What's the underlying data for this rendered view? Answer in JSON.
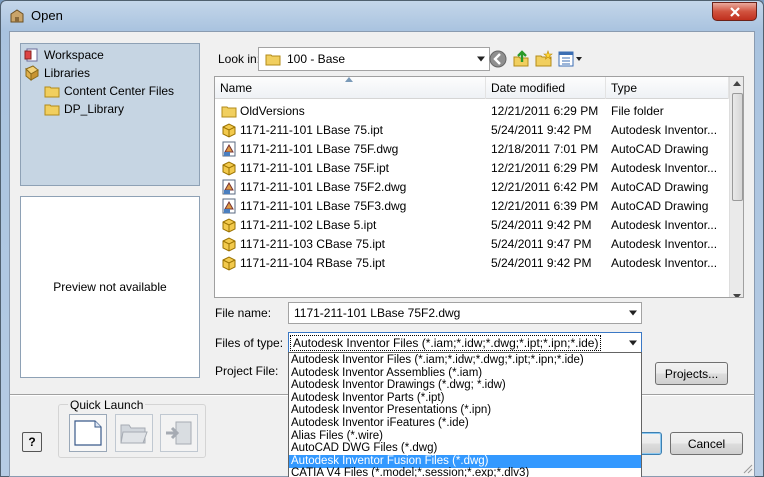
{
  "window": {
    "title": "Open"
  },
  "places": {
    "items": [
      {
        "label": "Workspace",
        "icon": "workspace-icon"
      },
      {
        "label": "Libraries",
        "icon": "libraries-icon"
      },
      {
        "label": "Content Center Files",
        "icon": "folder-icon"
      },
      {
        "label": "DP_Library",
        "icon": "folder-icon"
      }
    ]
  },
  "preview": {
    "text": "Preview not available"
  },
  "lookin": {
    "label": "Look in:",
    "value": "100 - Base"
  },
  "filelist": {
    "columns": [
      "Name",
      "Date modified",
      "Type"
    ],
    "rows": [
      {
        "name": "OldVersions",
        "date": "12/21/2011 6:29 PM",
        "type": "File folder",
        "icon": "folder-icon"
      },
      {
        "name": "1171-211-101 LBase 75.ipt",
        "date": "5/24/2011 9:42 PM",
        "type": "Autodesk Inventor...",
        "icon": "inventor-part-icon"
      },
      {
        "name": "1171-211-101 LBase 75F.dwg",
        "date": "12/18/2011 7:01 PM",
        "type": "AutoCAD Drawing",
        "icon": "dwg-icon"
      },
      {
        "name": "1171-211-101 LBase 75F.ipt",
        "date": "12/21/2011 6:29 PM",
        "type": "Autodesk Inventor...",
        "icon": "inventor-part-icon"
      },
      {
        "name": "1171-211-101 LBase 75F2.dwg",
        "date": "12/21/2011 6:42 PM",
        "type": "AutoCAD Drawing",
        "icon": "dwg-icon"
      },
      {
        "name": "1171-211-101 LBase 75F3.dwg",
        "date": "12/21/2011 6:39 PM",
        "type": "AutoCAD Drawing",
        "icon": "dwg-icon"
      },
      {
        "name": "1171-211-102 LBase 5.ipt",
        "date": "5/24/2011 9:42 PM",
        "type": "Autodesk Inventor...",
        "icon": "inventor-part-icon"
      },
      {
        "name": "1171-211-103 CBase 75.ipt",
        "date": "5/24/2011 9:47 PM",
        "type": "Autodesk Inventor...",
        "icon": "inventor-part-icon"
      },
      {
        "name": "1171-211-104 RBase 75.ipt",
        "date": "5/24/2011 9:42 PM",
        "type": "Autodesk Inventor...",
        "icon": "inventor-part-icon"
      }
    ]
  },
  "filename": {
    "label": "File name:",
    "value": "1171-211-101 LBase 75F2.dwg"
  },
  "filetype": {
    "label": "Files of type:",
    "value": "Autodesk Inventor Files (*.iam;*.idw;*.dwg;*.ipt;*.ipn;*.ide)",
    "options": [
      "Autodesk Inventor Files (*.iam;*.idw;*.dwg;*.ipt;*.ipn;*.ide)",
      "Autodesk Inventor Assemblies (*.iam)",
      "Autodesk Inventor Drawings (*.dwg; *.idw)",
      "Autodesk Inventor Parts (*.ipt)",
      "Autodesk Inventor Presentations (*.ipn)",
      "Autodesk Inventor iFeatures (*.ide)",
      "Alias Files (*.wire)",
      "AutoCAD DWG Files (*.dwg)",
      "Autodesk Inventor Fusion Files (*.dwg)",
      "CATIA V4 Files (*.model;*.session;*.exp;*.dlv3)"
    ],
    "highlighted_index": 8
  },
  "project": {
    "label": "Project File:",
    "button": "Projects..."
  },
  "quick_launch": {
    "label": "Quick Launch"
  },
  "buttons": {
    "cancel": "Cancel"
  },
  "colors": {
    "selection": "#3399ff",
    "panel": "#c6d5e3",
    "close": "#c0301e"
  }
}
